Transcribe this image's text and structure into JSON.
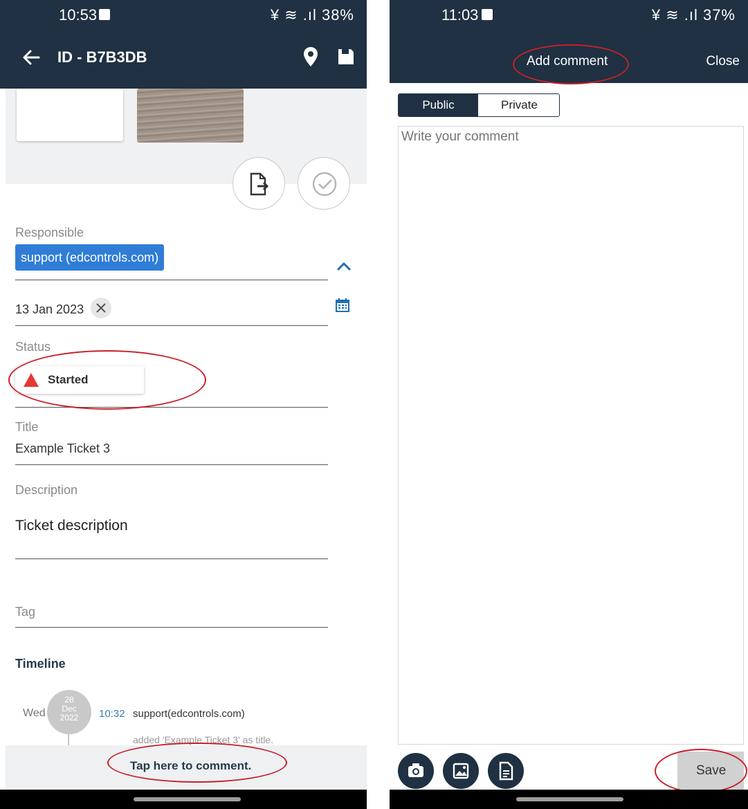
{
  "left": {
    "status_bar": {
      "time": "10:53",
      "system": "¥ ≋ .ıl 38%"
    },
    "header": {
      "title": "ID - B7B3DB"
    },
    "responsible": {
      "label": "Responsible",
      "value": "support (edcontrols.com)"
    },
    "due_date": {
      "value": "13 Jan 2023"
    },
    "status": {
      "label": "Status",
      "value": "Started",
      "color": "#e53935"
    },
    "title": {
      "label": "Title",
      "value": "Example Ticket 3"
    },
    "description": {
      "label": "Description",
      "value": "Ticket description"
    },
    "tag": {
      "label": "Tag"
    },
    "timeline": {
      "heading": "Timeline",
      "entry": {
        "weekday": "Wed",
        "day": "28",
        "month": "Dec",
        "year": "2022",
        "time": "10:32",
        "user": "support(edcontrols.com)",
        "action": "added 'Example Ticket 3' as title."
      }
    },
    "comment_bar": {
      "label": "Tap here to comment."
    }
  },
  "right": {
    "status_bar": {
      "time": "11:03",
      "system": "¥ ≋ .ıl 37%"
    },
    "header": {
      "title": "Add comment",
      "close_label": "Close"
    },
    "visibility_tabs": [
      "Public",
      "Private"
    ],
    "comment": {
      "placeholder": "Write your comment"
    },
    "save_label": "Save"
  },
  "colors": {
    "brand_navy": "#1f3142",
    "chip_blue": "#2f7dd6",
    "accent_blue": "#1e6fb0",
    "highlight_red": "#c8202a"
  },
  "icons": [
    "back-arrow-icon",
    "location-pin-icon",
    "save-icon",
    "export-icon",
    "check-circle-icon",
    "chevron-up-icon",
    "close-icon",
    "calendar-icon",
    "warning-triangle-icon",
    "camera-icon",
    "image-icon",
    "document-icon"
  ]
}
